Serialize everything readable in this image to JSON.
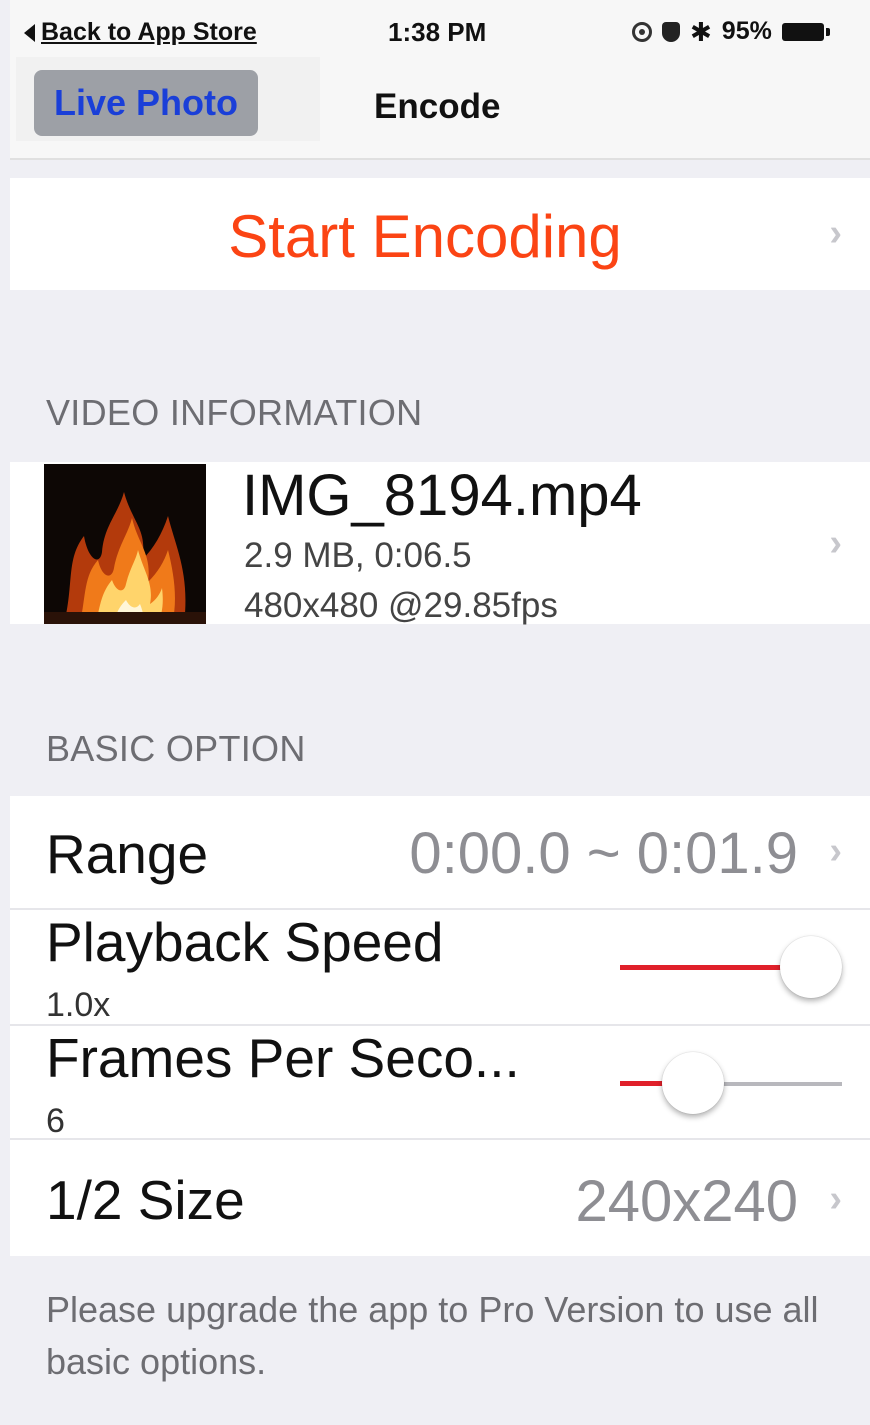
{
  "status_bar": {
    "back_label": "Back to App Store",
    "time": "1:38 PM",
    "battery_percent": "95%",
    "icons": [
      "location-icon",
      "shield-icon",
      "bluetooth-icon",
      "battery-icon"
    ]
  },
  "nav": {
    "segment_label": "Live Photo",
    "title": "Encode",
    "segment_color": "#1a3fd8"
  },
  "start": {
    "label": "Start Encoding",
    "color": "#fb4414"
  },
  "video": {
    "section_header": "VIDEO INFORMATION",
    "name": "IMG_8194.mp4",
    "meta1": "2.9 MB, 0:06.5",
    "meta2": "480x480 @29.85fps"
  },
  "options": {
    "section_header": "BASIC OPTION",
    "range": {
      "label": "Range",
      "value": "0:00.0 ~ 0:01.9"
    },
    "playback": {
      "label": "Playback Speed",
      "value": "1.0x",
      "slider_level": 1.0
    },
    "fps": {
      "label": "Frames Per Seco...",
      "value": "6",
      "slider_level": 0.38
    },
    "size": {
      "label": "1/2 Size",
      "value": "240x240"
    },
    "slider_color": "#e0202a"
  },
  "footer": {
    "text": "Please upgrade the app to Pro Version to use all basic options."
  }
}
